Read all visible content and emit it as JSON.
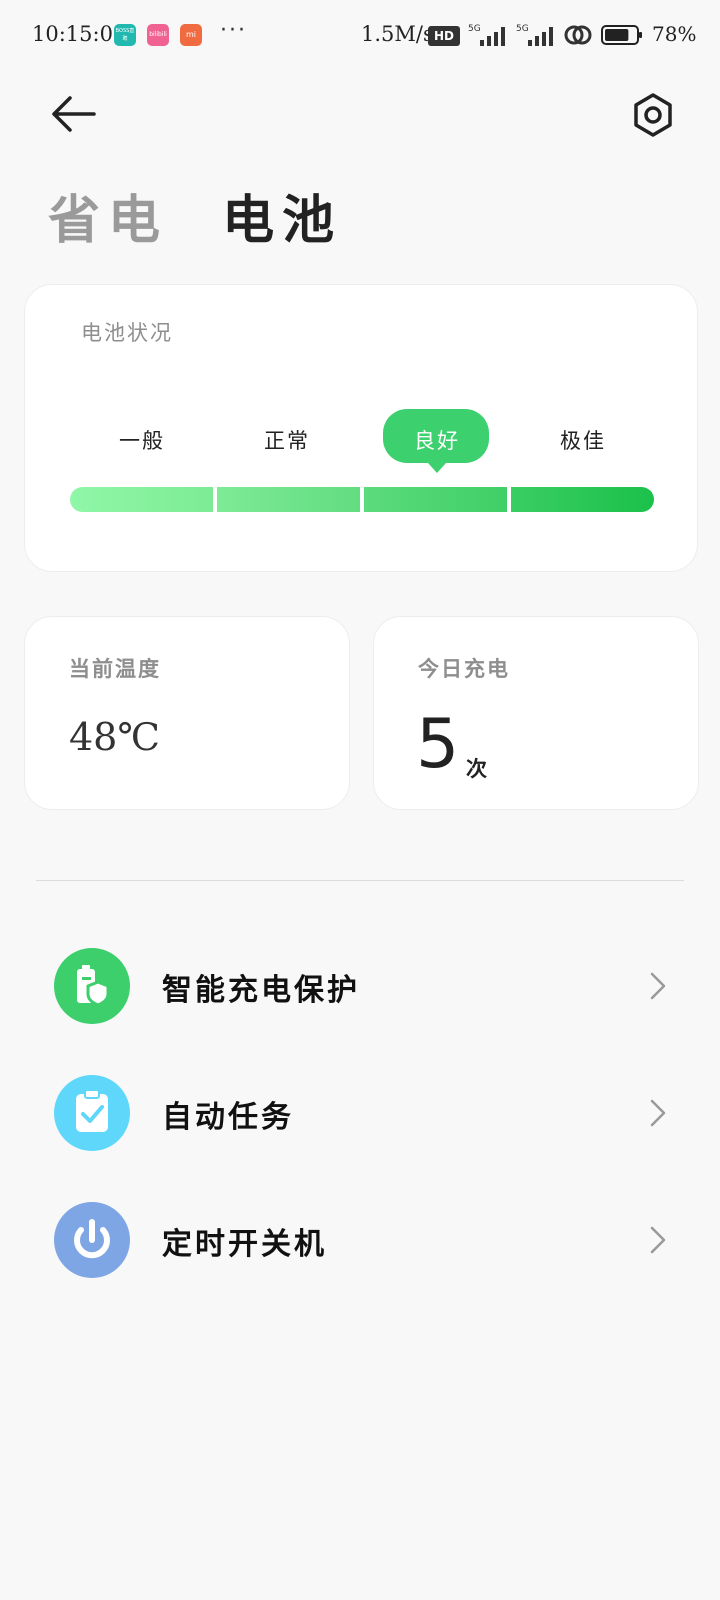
{
  "status_bar": {
    "time": "10:15:05",
    "apps": [
      {
        "name": "boss-zhipin",
        "label": "BOSS直聘"
      },
      {
        "name": "bilibili",
        "label": "bilibili"
      },
      {
        "name": "mi",
        "label": "mi"
      }
    ],
    "more": "···",
    "net_speed": "1.5M/s",
    "hd": "HD",
    "signal_1": "5G",
    "signal_2": "5G",
    "battery_level": 0.78,
    "battery_percent": "78%"
  },
  "header": {
    "tabs": [
      {
        "label": "省电",
        "active": false
      },
      {
        "label": "电池",
        "active": true
      }
    ]
  },
  "battery_status": {
    "label": "电池状况",
    "levels": [
      "一般",
      "正常",
      "良好",
      "极佳"
    ],
    "selected_index": 2
  },
  "temperature": {
    "label": "当前温度",
    "value": "48℃"
  },
  "charges_today": {
    "label": "今日充电",
    "count": "5",
    "unit": "次"
  },
  "menu": [
    {
      "label": "智能充电保护",
      "icon": "battery-shield-icon",
      "color": "#3ccf6b"
    },
    {
      "label": "自动任务",
      "icon": "clipboard-check-icon",
      "color": "#5ed7fb"
    },
    {
      "label": "定时开关机",
      "icon": "power-icon",
      "color": "#7ea6e5"
    }
  ],
  "colors": {
    "accent_green": "#3dd06e",
    "background": "#f8f8f8"
  }
}
